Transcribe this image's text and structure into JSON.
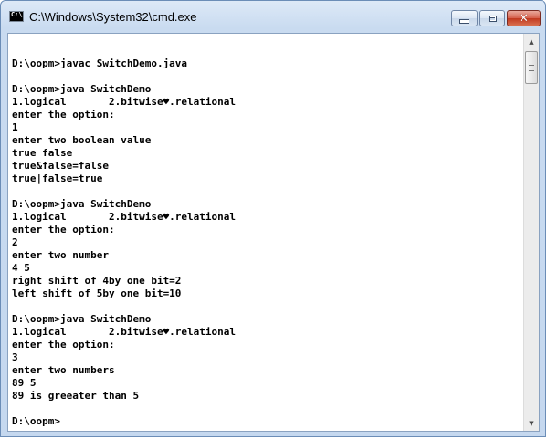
{
  "window": {
    "title": "C:\\Windows\\System32\\cmd.exe",
    "icon": "cmd-console-icon",
    "close_glyph": "✕"
  },
  "console": {
    "lines": [
      "",
      "D:\\oopm>javac SwitchDemo.java",
      "",
      "D:\\oopm>java SwitchDemo",
      "1.logical       2.bitwise♥.relational",
      "enter the option:",
      "1",
      "enter two boolean value",
      "true false",
      "true&false=false",
      "true|false=true",
      "",
      "D:\\oopm>java SwitchDemo",
      "1.logical       2.bitwise♥.relational",
      "enter the option:",
      "2",
      "enter two number",
      "4 5",
      "right shift of 4by one bit=2",
      "left shift of 5by one bit=10",
      "",
      "D:\\oopm>java SwitchDemo",
      "1.logical       2.bitwise♥.relational",
      "enter the option:",
      "3",
      "enter two numbers",
      "89 5",
      "89 is greeater than 5",
      "",
      "D:\\oopm>"
    ]
  },
  "scrollbar": {
    "up_arrow": "▲",
    "down_arrow": "▼"
  }
}
